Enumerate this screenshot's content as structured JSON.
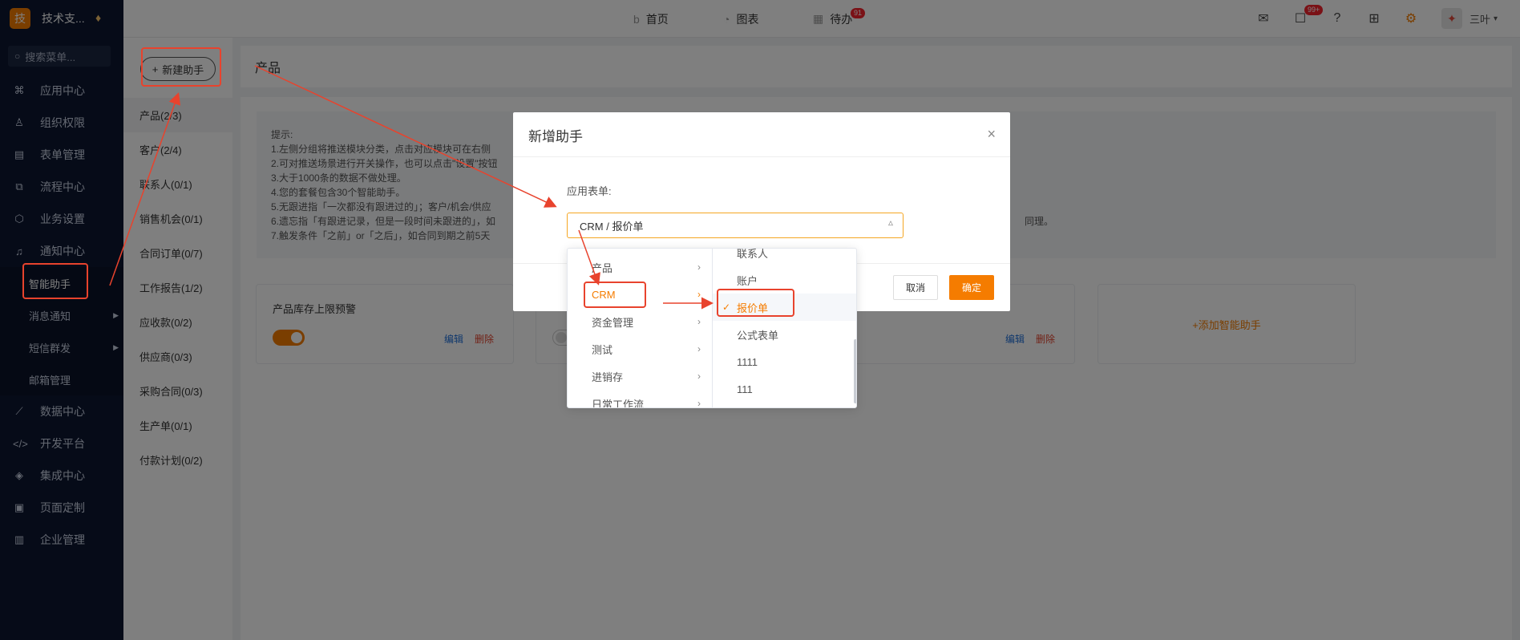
{
  "brand": {
    "logo": "技",
    "name": "技术支...",
    "gem_icon": "diamond-icon"
  },
  "sidebar": {
    "search_placeholder": "搜索菜单...",
    "items": [
      {
        "label": "应用中心",
        "icon": "apps-icon"
      },
      {
        "label": "组织权限",
        "icon": "user-icon"
      },
      {
        "label": "表单管理",
        "icon": "form-icon"
      },
      {
        "label": "流程中心",
        "icon": "flow-icon"
      },
      {
        "label": "业务设置",
        "icon": "cube-icon"
      },
      {
        "label": "通知中心",
        "icon": "bell-icon"
      }
    ],
    "sub_items": [
      {
        "label": "智能助手"
      },
      {
        "label": "消息通知"
      },
      {
        "label": "短信群发"
      },
      {
        "label": "邮箱管理"
      }
    ],
    "items_bottom": [
      {
        "label": "数据中心",
        "icon": "chart-icon"
      },
      {
        "label": "开发平台",
        "icon": "code-icon"
      },
      {
        "label": "集成中心",
        "icon": "layers-icon"
      },
      {
        "label": "页面定制",
        "icon": "layout-icon"
      },
      {
        "label": "企业管理",
        "icon": "building-icon"
      }
    ]
  },
  "topbar": {
    "tabs": [
      {
        "label": "首页",
        "icon": "home-icon"
      },
      {
        "label": "图表",
        "icon": "pie-icon"
      },
      {
        "label": "待办",
        "icon": "todo-icon",
        "badge": "91"
      }
    ],
    "message_badge": "99+",
    "user_name": "三叶"
  },
  "groups": {
    "new_button": "新建助手",
    "items": [
      "产品(2/3)",
      "客户(2/4)",
      "联系人(0/1)",
      "销售机会(0/1)",
      "合同订单(0/7)",
      "工作报告(1/2)",
      "应收款(0/2)",
      "供应商(0/3)",
      "采购合同(0/3)",
      "生产单(0/1)",
      "付款计划(0/2)"
    ]
  },
  "main": {
    "title": "产品",
    "tips": [
      "提示:",
      "1.左侧分组将推送模块分类，点击对应模块可在右侧",
      "2.可对推送场景进行开关操作，也可以点击\"设置\"按钮",
      "3.大于1000条的数据不做处理。",
      "4.您的套餐包含30个智能助手。",
      "5.无跟进指「一次都没有跟进过的」；客户/机会/供应",
      "6.遗忘指「有跟进记录，但是一段时间未跟进的」，如",
      "7.触发条件「之前」or「之后」，如合同到期之前5天"
    ],
    "tips_tail": "同理。",
    "cards": [
      {
        "title": "产品库存上限预警",
        "edit": "编辑",
        "delete": "删除"
      },
      {
        "edit": "编辑",
        "delete": "删除"
      }
    ],
    "add_card": "+添加智能助手"
  },
  "modal": {
    "title": "新增助手",
    "field_label": "应用表单:",
    "field_value": "CRM / 报价单",
    "cancel": "取消",
    "ok": "确定"
  },
  "cascader": {
    "col1": [
      "产品",
      "CRM",
      "资金管理",
      "测试",
      "进销存",
      "日常工作流"
    ],
    "col2": [
      "联系人",
      "账户",
      "报价单",
      "公式表单",
      "1111",
      "111"
    ]
  },
  "colors": {
    "accent": "#f57c00",
    "annotation": "#e8432d",
    "sidebar": "#0c1731"
  }
}
